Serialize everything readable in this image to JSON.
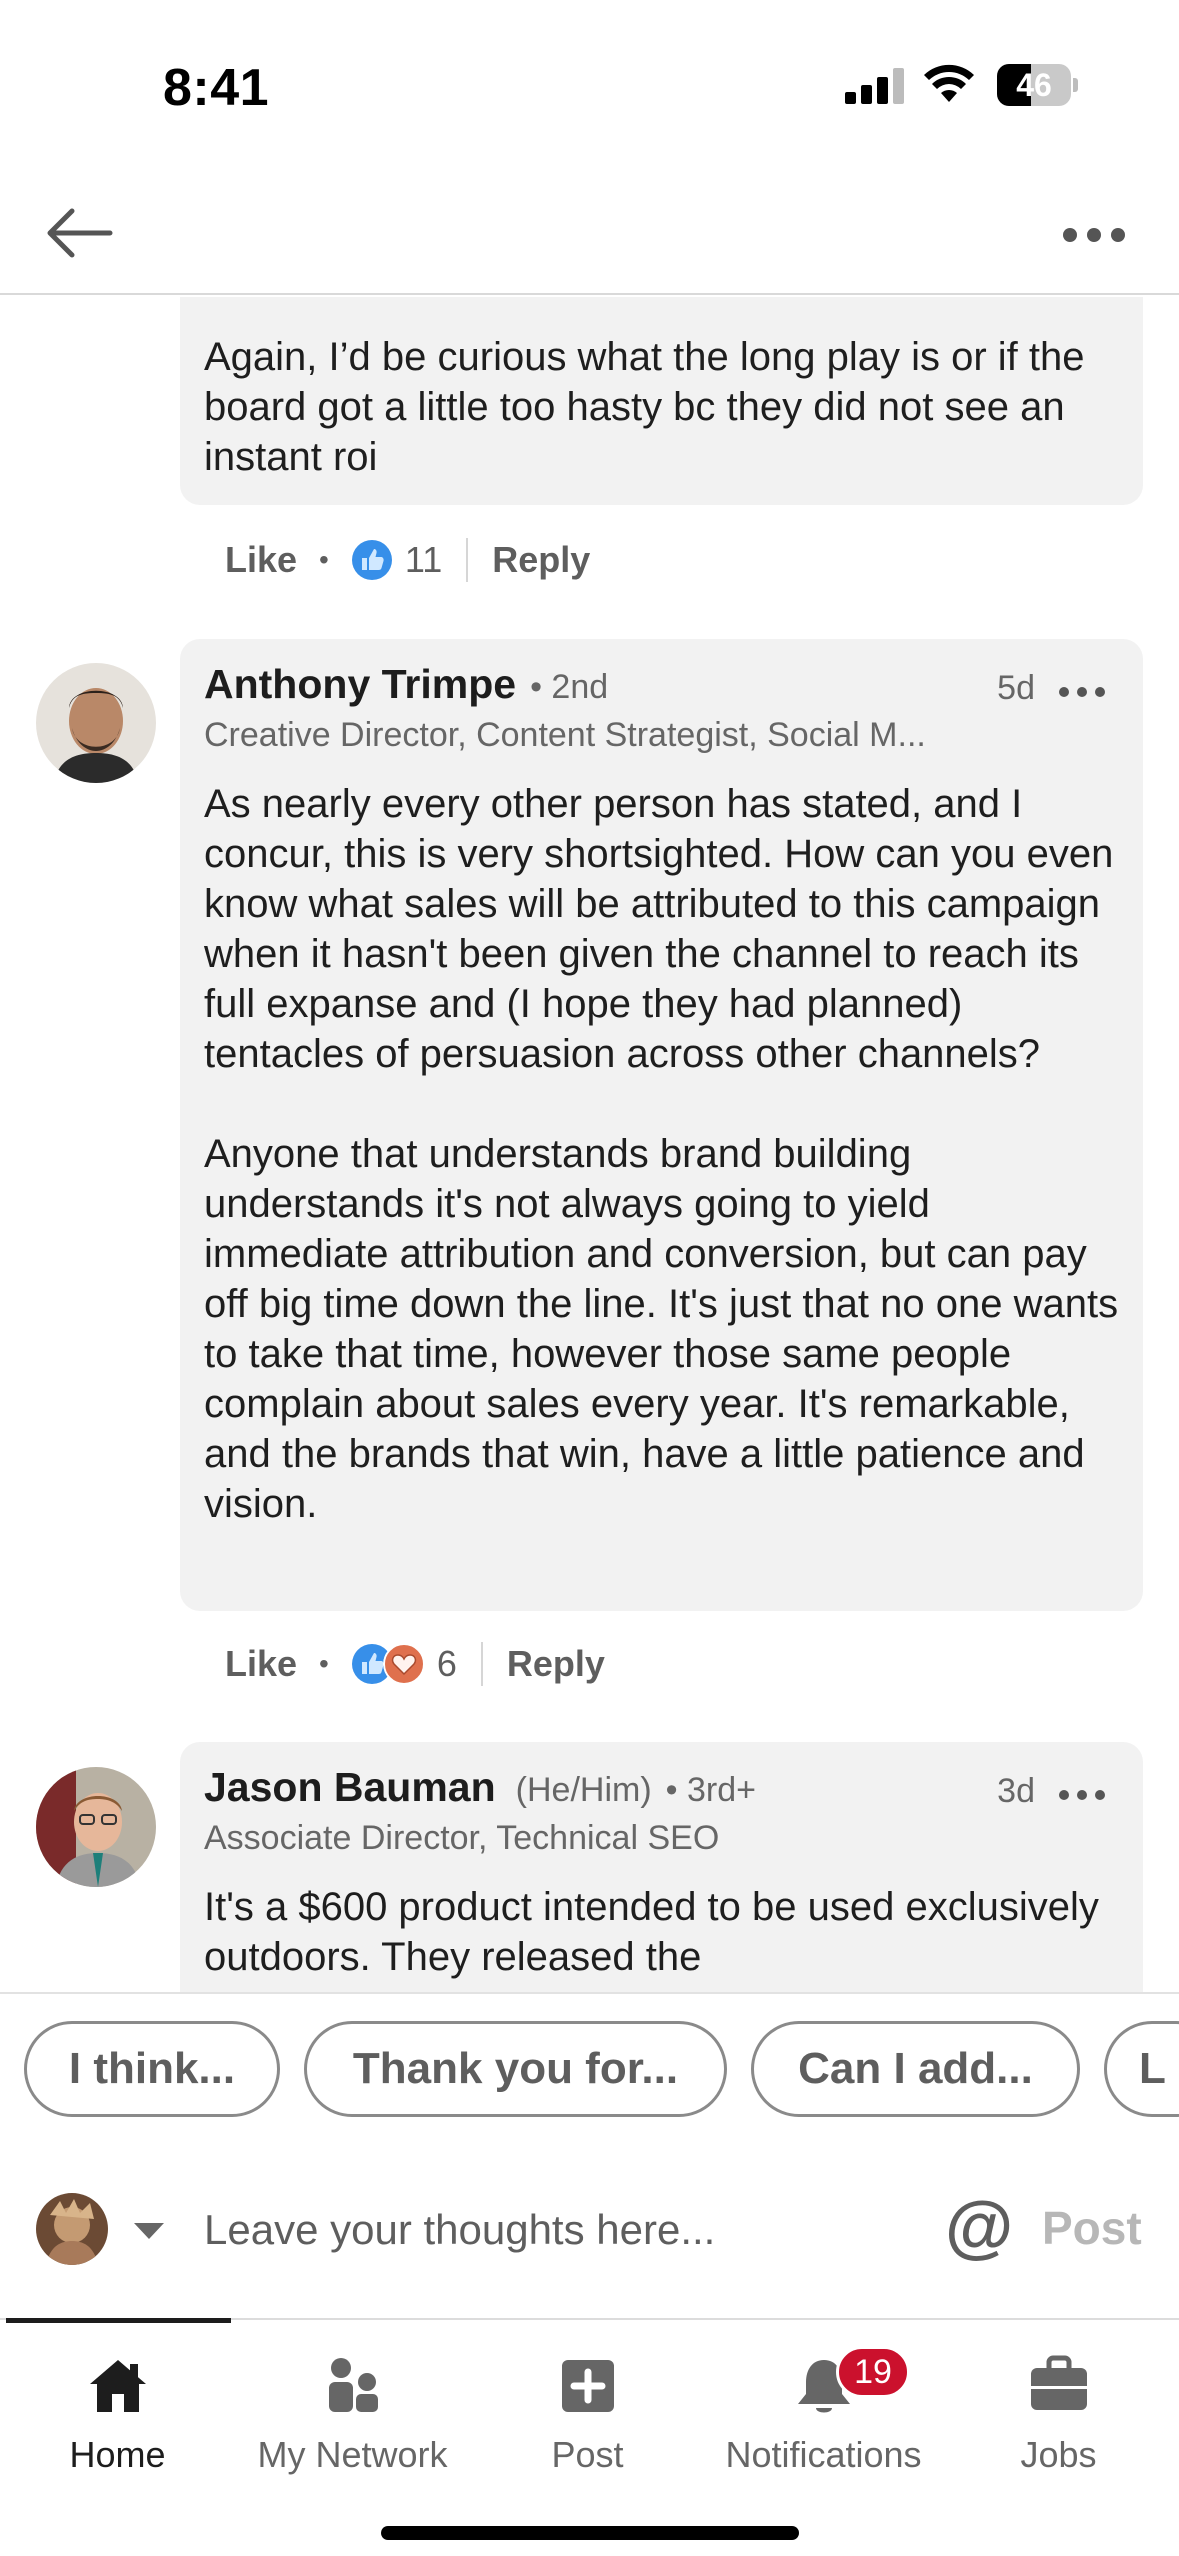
{
  "status_bar": {
    "time": "8:41",
    "battery": "46",
    "battery_level": 0.46
  },
  "header": {
    "back_icon": "arrow-left-icon",
    "more_icon": "more-horizontal-icon"
  },
  "comments": [
    {
      "text": "Again, I’d be curious what the long play is or if the board got a little too hasty bc they did not see an instant roi",
      "like_label": "Like",
      "reaction_count": "11",
      "reactions": [
        "like"
      ],
      "reply_label": "Reply"
    },
    {
      "name": "Anthony Trimpe",
      "degree": "• 2nd",
      "time": "5d",
      "headline": "Creative Director, Content Strategist, Social M...",
      "text": "As nearly every other person has stated, and I concur, this is very shortsighted. How can you even know what sales will be attributed to this campaign when it hasn't been given the channel to reach its full expanse and (I hope they had planned) tentacles of persuasion across other channels?\n\nAnyone that understands brand building understands it's not always going to yield immediate attribution and conversion, but can pay off big time down the line. It's just that no one wants to take that time, however those same people complain about sales every year. It's remarkable, and the brands that win, have a little patience and vision.",
      "like_label": "Like",
      "reaction_count": "6",
      "reactions": [
        "like",
        "love"
      ],
      "reply_label": "Reply"
    },
    {
      "name": "Jason Bauman",
      "pronouns": "(He/Him)",
      "degree": "• 3rd+",
      "time": "3d",
      "headline": "Associate Director, Technical SEO",
      "text": "It's a $600 product intended to be used exclusively outdoors. They released the"
    }
  ],
  "suggestions": [
    "I think...",
    "Thank you for...",
    "Can I add...",
    "L"
  ],
  "composer": {
    "placeholder": "Leave your thoughts here...",
    "mention_label": "@",
    "post_label": "Post"
  },
  "tabs": [
    {
      "label": "Home",
      "icon": "home-icon",
      "active": true
    },
    {
      "label": "My Network",
      "icon": "network-icon",
      "active": false
    },
    {
      "label": "Post",
      "icon": "plus-square-icon",
      "active": false
    },
    {
      "label": "Notifications",
      "icon": "bell-icon",
      "active": false,
      "badge": "19"
    },
    {
      "label": "Jobs",
      "icon": "briefcase-icon",
      "active": false
    }
  ],
  "colors": {
    "like_blue": "#378fe9",
    "love_red": "#df704d",
    "badge_red": "#cb112d",
    "bubble_gray": "#f2f2f2"
  }
}
